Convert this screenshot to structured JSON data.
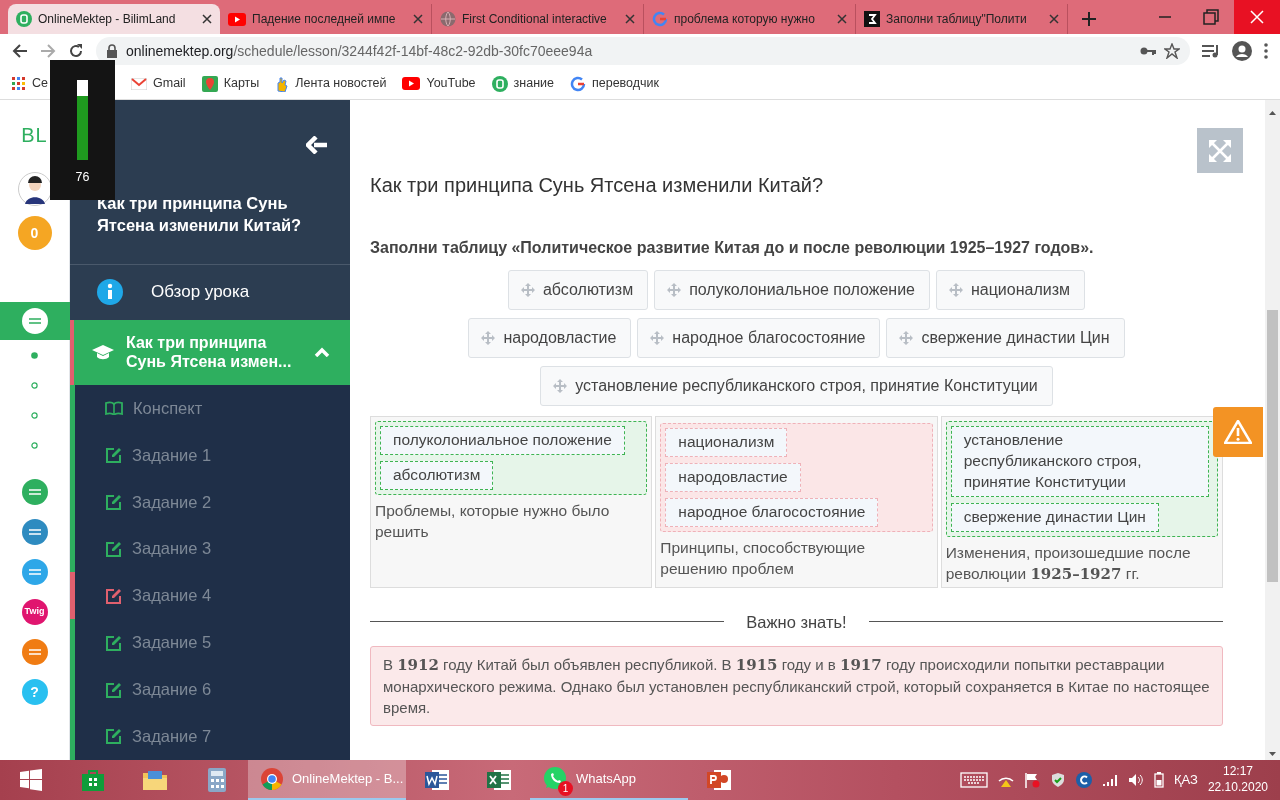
{
  "browser": {
    "tabs": [
      {
        "title": "OnlineMektep - BilimLand",
        "selected": true,
        "kind": "bilim"
      },
      {
        "title": "Падение последней импе",
        "selected": false,
        "kind": "youtube"
      },
      {
        "title": "First Conditional interactive",
        "selected": false,
        "kind": "globe"
      },
      {
        "title": "проблема которую нужно",
        "selected": false,
        "kind": "google"
      },
      {
        "title": "Заполни таблицу\"Полити",
        "selected": false,
        "kind": "square"
      }
    ],
    "address": {
      "host": "onlinemektep.org",
      "path": "/schedule/lesson/3244f42f-14bf-48c2-92db-30fc70eee94a"
    },
    "bookmarks": [
      {
        "label": "Се",
        "kind": "apps"
      },
      {
        "label": "Gmail",
        "kind": "gmail"
      },
      {
        "label": "Карты",
        "kind": "maps"
      },
      {
        "label": "Лента новостей",
        "kind": "news"
      },
      {
        "label": "YouTube",
        "kind": "youtube"
      },
      {
        "label": "знание",
        "kind": "bilim"
      },
      {
        "label": "переводчик",
        "kind": "google"
      }
    ]
  },
  "meter_overlay": {
    "level": 0.8,
    "reading": "76"
  },
  "rail": {
    "logo": "BL",
    "coins": "0",
    "apps": [
      {
        "kind": "onlinemektep",
        "selected": true
      },
      {
        "kind": "bilimland",
        "selected": false
      },
      {
        "kind": "bilimbook",
        "selected": false
      },
      {
        "kind": "test",
        "selected": false
      },
      {
        "kind": "twig",
        "selected": false,
        "label": "Twig"
      },
      {
        "kind": "imektep",
        "selected": false
      },
      {
        "kind": "help",
        "selected": false,
        "label": "?"
      }
    ],
    "dots": [
      {
        "selected": true
      },
      {
        "selected": false
      },
      {
        "selected": false
      },
      {
        "selected": false
      }
    ]
  },
  "sidebar": {
    "title": "Как три принципа Сунь Ятсена изменили Китай?",
    "overview": "Обзор урока",
    "section": {
      "title": "Как три принципа Сунь Ятсена измен...",
      "expanded": true,
      "color": "#e0606e"
    },
    "items": [
      {
        "label": "Конспект",
        "kind": "notes",
        "color": "#2eaf5f"
      },
      {
        "label": "Задание 1",
        "kind": "task",
        "color": "#2eaf5f"
      },
      {
        "label": "Задание 2",
        "kind": "task",
        "color": "#2eaf5f"
      },
      {
        "label": "Задание 3",
        "kind": "task",
        "color": "#2eaf5f"
      },
      {
        "label": "Задание 4",
        "kind": "task",
        "color": "#e0606e"
      },
      {
        "label": "Задание 5",
        "kind": "task",
        "color": "#2eaf5f"
      },
      {
        "label": "Задание 6",
        "kind": "task",
        "color": "#2eaf5f"
      },
      {
        "label": "Задание 7",
        "kind": "task",
        "color": "#2eaf5f"
      }
    ]
  },
  "main": {
    "title": "Как три принципа Сунь Ятсена изменили Китай?",
    "instruction": "Заполни таблицу «Политическое развитие Китая до и после революции 1925–1927 годов».",
    "chips": [
      "абсолютизм",
      "полуколониальное положение",
      "национализм",
      "народовластие",
      "народное благосостояние",
      "свержение династии Цин",
      "установление республиканского строя, принятие Конституции"
    ],
    "columns": [
      {
        "correct": true,
        "items": [
          "полуколониальное положение",
          "абсолютизм"
        ],
        "caption": "Проблемы, которые нужно было решить"
      },
      {
        "correct": false,
        "items": [
          "национализм",
          "народовластие",
          "народное благосостояние"
        ],
        "caption": "Принципы, способствующие решению проблем"
      },
      {
        "correct": true,
        "items": [
          "установление республиканского строя, принятие Конституции",
          "свержение династии Цин"
        ],
        "caption": "Изменения, произошедшие после революции **1925–1927** гг."
      }
    ],
    "note": {
      "heading": "Важно знать!",
      "text": "В **1912** году Китай был объявлен республикой. В **1915** году и в **1917** году происходили попытки реставрации монархического режима. Однако был установлен республиканский строй, который сохраняется в Китае по настоящее время."
    }
  },
  "taskbar": {
    "apps": [
      {
        "kind": "start",
        "selected": false
      },
      {
        "kind": "store",
        "selected": false
      },
      {
        "kind": "explorer",
        "selected": false
      },
      {
        "kind": "calculator",
        "selected": false
      },
      {
        "kind": "chrome",
        "selected": true,
        "label": "OnlineMektep - B..."
      },
      {
        "kind": "word",
        "selected": false
      },
      {
        "kind": "excel",
        "selected": false
      },
      {
        "kind": "whatsapp",
        "selected": false,
        "label": "WhatsApp",
        "badge": "1"
      },
      {
        "kind": "powerpoint",
        "selected": false
      }
    ],
    "language": "ҚАЗ",
    "time": "12:17",
    "date": "22.10.2020"
  }
}
